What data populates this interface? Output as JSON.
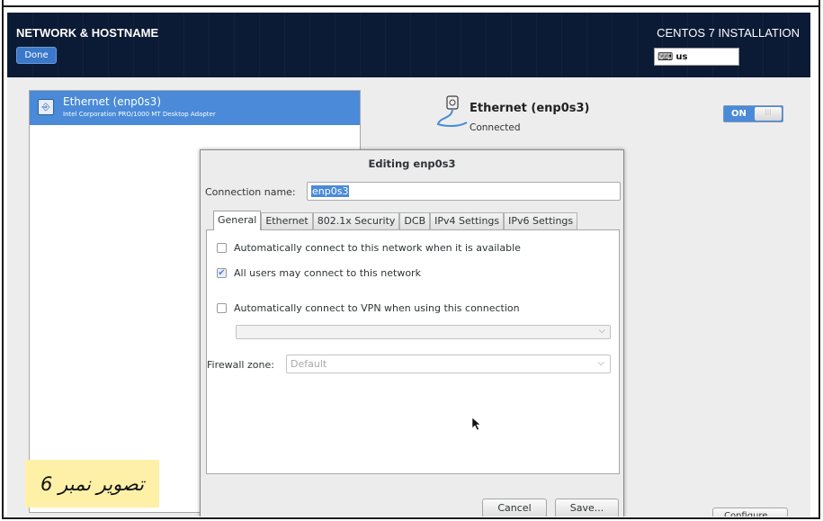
{
  "header": {
    "title": "NETWORK & HOSTNAME",
    "done_label": "Done",
    "product": "CENTOS 7 INSTALLATION",
    "keyboard_icon": "keyboard-icon",
    "keyboard_layout": "us"
  },
  "device_list": {
    "items": [
      {
        "name": "Ethernet (enp0s3)",
        "description": "Intel Corporation PRO/1000 MT Desktop Adapter",
        "icon": "ethernet-icon",
        "selected": true
      }
    ]
  },
  "device_detail": {
    "name": "Ethernet (enp0s3)",
    "status": "Connected",
    "icon": "ethernet-cable-icon",
    "toggle": {
      "on_label": "ON",
      "off_label": "III",
      "state": "on"
    },
    "configure_label": "Configure..."
  },
  "dialog": {
    "title": "Editing enp0s3",
    "connection_label": "Connection name:",
    "connection_value": "enp0s3",
    "tabs": [
      {
        "label": "General",
        "active": true
      },
      {
        "label": "Ethernet"
      },
      {
        "label": "802.1x Security"
      },
      {
        "label": "DCB"
      },
      {
        "label": "IPv4 Settings"
      },
      {
        "label": "IPv6 Settings"
      }
    ],
    "general": {
      "auto_connect": {
        "label": "Automatically connect to this network when it is available",
        "checked": false
      },
      "all_users": {
        "label": "All users may connect to this network",
        "checked": true
      },
      "auto_vpn": {
        "label": "Automatically connect to VPN when using this connection",
        "checked": false
      },
      "vpn_value": "",
      "firewall_label": "Firewall zone:",
      "firewall_value": "Default"
    },
    "cancel_label": "Cancel",
    "save_label": "Save..."
  },
  "caption": "تصویر نمبر 6",
  "colors": {
    "header_bg": "#0b1a35",
    "accent": "#4a8ad8",
    "caption_bg": "#fff0a8"
  }
}
